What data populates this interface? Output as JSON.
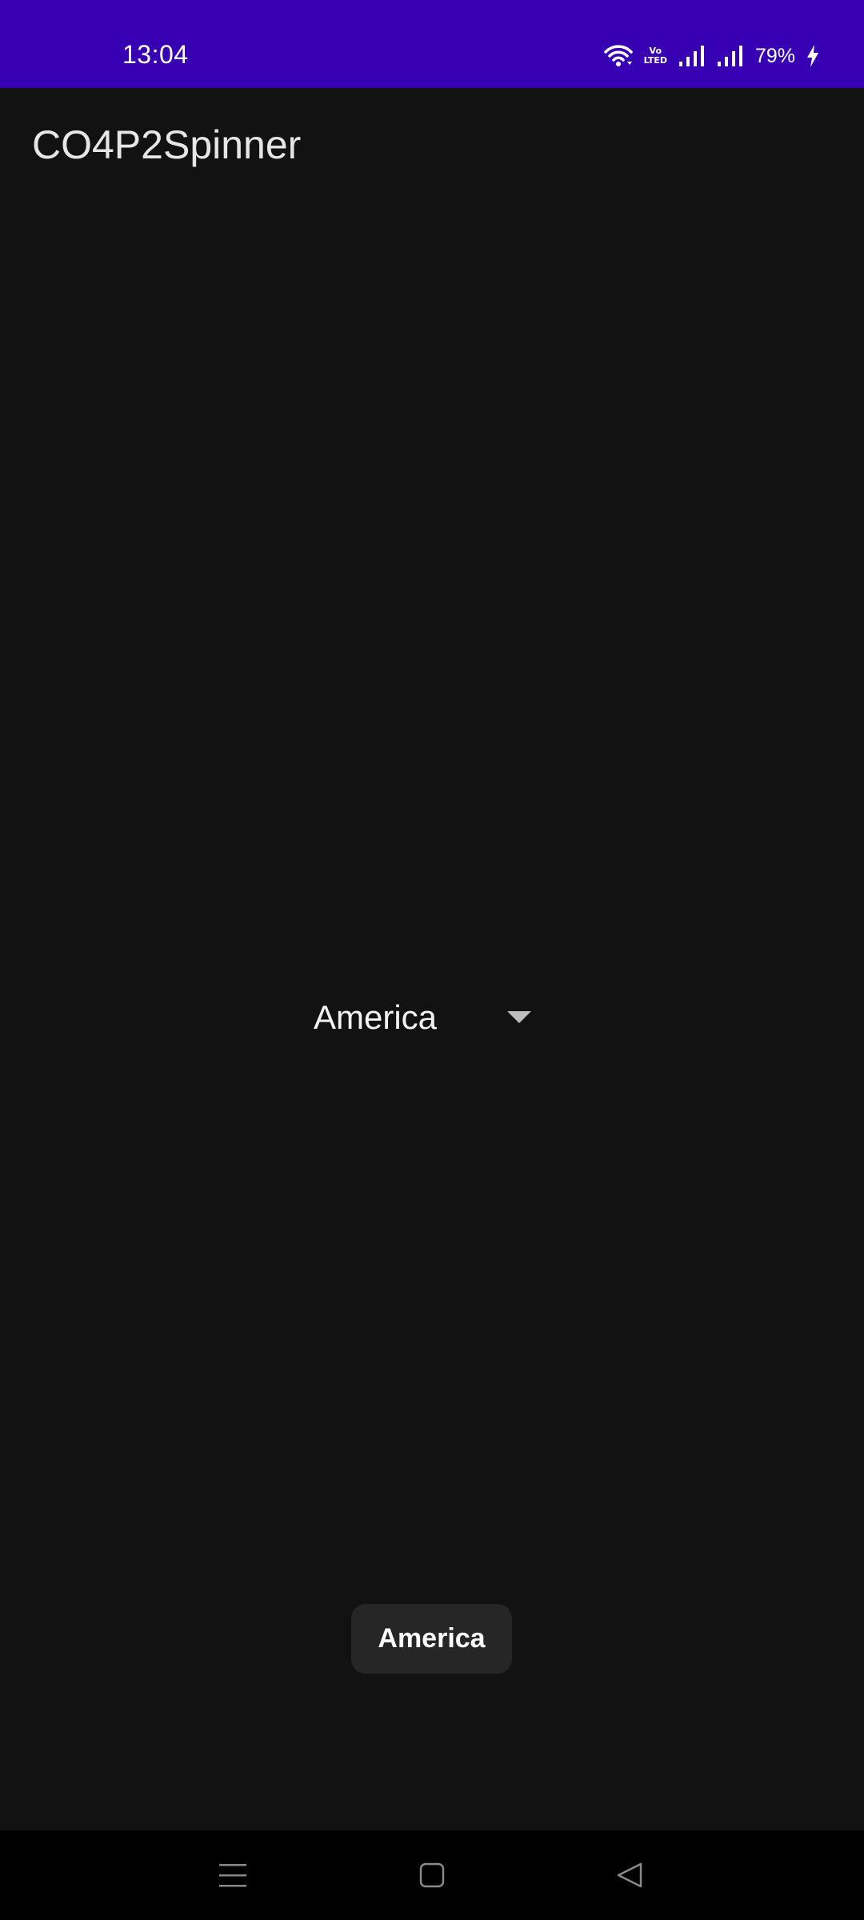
{
  "status_bar": {
    "time": "13:04",
    "battery": "79%",
    "volte_label_top": "Vo",
    "volte_label_bottom": "LTED",
    "icons": [
      "wifi-icon",
      "volte-icon",
      "signal-icon",
      "signal-icon",
      "charging-icon"
    ],
    "background_color": "#3700b3"
  },
  "app_bar": {
    "title": "CO4P2Spinner"
  },
  "spinner": {
    "selected_value": "America"
  },
  "toast": {
    "message": "America"
  },
  "nav_bar": {
    "buttons": [
      "menu-icon",
      "home-icon",
      "back-icon"
    ]
  }
}
